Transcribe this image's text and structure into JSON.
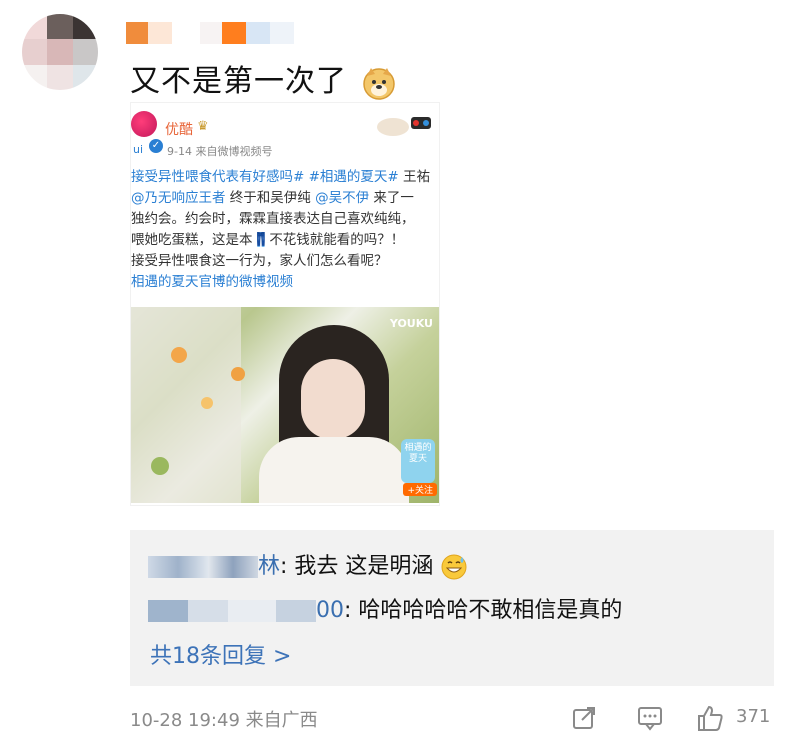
{
  "comment": {
    "text": "又不是第一次了",
    "emoji": "doge-emoji"
  },
  "embed": {
    "account_name": "优酷",
    "logo_sub": "ui",
    "meta": "9-14  来自微博视频号",
    "lines": [
      {
        "parts": [
          {
            "t": "接受异性喂食代表有好感吗# #相遇的夏天# ",
            "tag": true
          },
          {
            "t": "王祐",
            "tag": false
          }
        ]
      },
      {
        "parts": [
          {
            "t": "@乃无响应王者",
            "tag": true
          },
          {
            "t": " 终于和吴伊纯 ",
            "tag": false
          },
          {
            "t": "@吴不伊",
            "tag": true
          },
          {
            "t": " 来了一",
            "tag": false
          }
        ]
      },
      {
        "parts": [
          {
            "t": "独约会。约会时，霖霖直接表达自己喜欢纯纯，",
            "tag": false
          }
        ]
      },
      {
        "parts": [
          {
            "t": "喂她吃蛋糕，这是本",
            "tag": false
          },
          {
            "t": "👖",
            "tag": false
          },
          {
            "t": "不花钱就能看的吗？！",
            "tag": false
          }
        ]
      },
      {
        "parts": [
          {
            "t": "接受异性喂食这一行为，家人们怎么看呢？",
            "tag": false
          }
        ]
      },
      {
        "parts": [
          {
            "t": "相遇的夏天官博的微博视频",
            "tag": true
          }
        ]
      }
    ],
    "video": {
      "watermark": "YOUKU",
      "sticker": "相遇的夏天",
      "follow": "+关注"
    }
  },
  "replies": [
    {
      "who": "林",
      "text": ": 我去 这是明涵",
      "emoji": "sweat-smile-emoji"
    },
    {
      "who": "00",
      "text": ": 哈哈哈哈哈不敢相信是真的"
    }
  ],
  "more_replies": "共18条回复 >",
  "footer": {
    "time": "10-28 19:49 来自广西",
    "likes": "371"
  },
  "colors": {
    "link": "#3d73b8",
    "reply_bg": "#f2f2f2",
    "meta": "#8a8a8a"
  }
}
